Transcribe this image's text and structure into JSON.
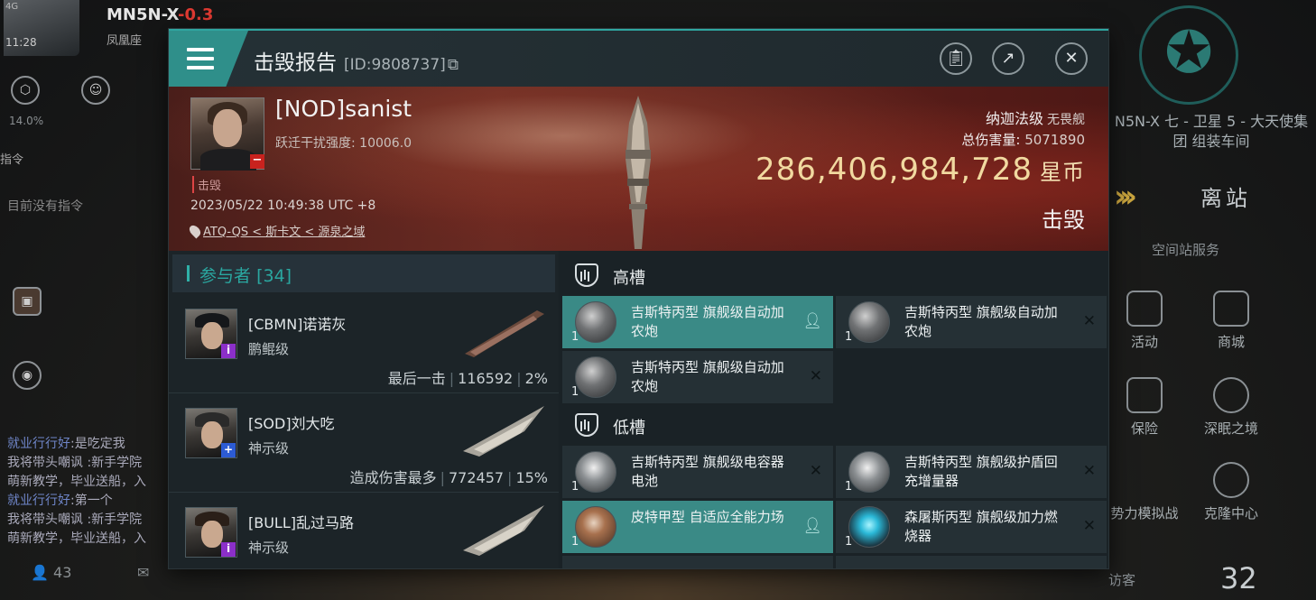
{
  "hud": {
    "signal": "4G",
    "time": "11:28",
    "system": "MN5N-X",
    "security": "-0.3",
    "subsystem": "凤凰座",
    "security_pct": "14.0%",
    "overview_label": "MN5N-X",
    "command_tab": "指令",
    "no_commands": "目前没有指令",
    "chat": [
      {
        "name": "就业行行好",
        "text": ":是吃定我"
      },
      {
        "name": "",
        "text": "我将带头嘲讽 :新手学院"
      },
      {
        "name": "",
        "text": "萌新教学，毕业送船，入"
      },
      {
        "name": "就业行行好",
        "text": ":第一个"
      },
      {
        "name": "",
        "text": "我将带头嘲讽 :新手学院"
      },
      {
        "name": "",
        "text": "萌新教学，毕业送船，入"
      }
    ],
    "online_count": "43",
    "station_name": "N5N-X 七 - 卫星 5 - 大天使集团 组装车间",
    "leave_station": "离站",
    "station_services": "空间站服务",
    "services": [
      {
        "label": "活动"
      },
      {
        "label": "商城"
      },
      {
        "label": "保险"
      },
      {
        "label": "深眠之境"
      },
      {
        "label": "势力模拟战"
      },
      {
        "label": "克隆中心"
      }
    ],
    "visitor": "访客",
    "visitor_count": "32"
  },
  "report": {
    "title": "击毁报告",
    "id_text": "[ID:9808737]",
    "victim": {
      "name": "[NOD]sanist",
      "warp_label": "跃迁干扰强度:",
      "warp_value": "10006.0",
      "status_tag": "击毁",
      "datetime": "2023/05/22 10:49:38 UTC +8",
      "location": "ATQ-QS < 斯卡文 < 源泉之域"
    },
    "ship": {
      "class_name": "纳迦法级",
      "category": "无畏舰",
      "damage_label": "总伤害量:",
      "damage_value": "5071890",
      "isk_value": "286,406,984,728",
      "isk_unit": "星币",
      "result": "击毁"
    },
    "participants": {
      "label": "参与者",
      "count": "[34]",
      "rows": [
        {
          "name": "[CBMN]诺诺灰",
          "ship": "鹏鲲级",
          "tag": "最后一击",
          "damage": "116592",
          "pct": "2%",
          "badge": "i",
          "badge_color": "#8b2fc9"
        },
        {
          "name": "[SOD]刘大吃",
          "ship": "神示级",
          "tag": "造成伤害最多",
          "damage": "772457",
          "pct": "15%",
          "badge": "+",
          "badge_color": "#2c5bd4"
        },
        {
          "name": "[BULL]乱过马路",
          "ship": "神示级",
          "tag": "",
          "damage": "",
          "pct": "",
          "badge": "i",
          "badge_color": "#8b2fc9"
        }
      ]
    },
    "high_slots": {
      "label": "高槽",
      "modules": [
        {
          "name": "吉斯特丙型 旗舰级自动加农炮",
          "qty": "1",
          "state": "dropped",
          "icon": "autocannon-icon"
        },
        {
          "name": "吉斯特丙型 旗舰级自动加农炮",
          "qty": "1",
          "state": "destroyed",
          "icon": "autocannon-icon"
        },
        {
          "name": "吉斯特丙型 旗舰级自动加农炮",
          "qty": "1",
          "state": "destroyed",
          "icon": "autocannon-icon"
        }
      ]
    },
    "low_slots": {
      "label": "低槽",
      "modules": [
        {
          "name": "吉斯特丙型 旗舰级电容器电池",
          "qty": "1",
          "state": "destroyed",
          "icon": "capacitor-battery-icon"
        },
        {
          "name": "吉斯特丙型 旗舰级护盾回充增量器",
          "qty": "1",
          "state": "destroyed",
          "icon": "shield-extender-icon"
        },
        {
          "name": "皮特甲型 自适应全能力场",
          "qty": "1",
          "state": "dropped",
          "icon": "adaptive-field-icon"
        },
        {
          "name": "森屠斯丙型 旗舰级加力燃烧器",
          "qty": "1",
          "state": "destroyed",
          "icon": "afterburner-icon"
        }
      ]
    }
  }
}
